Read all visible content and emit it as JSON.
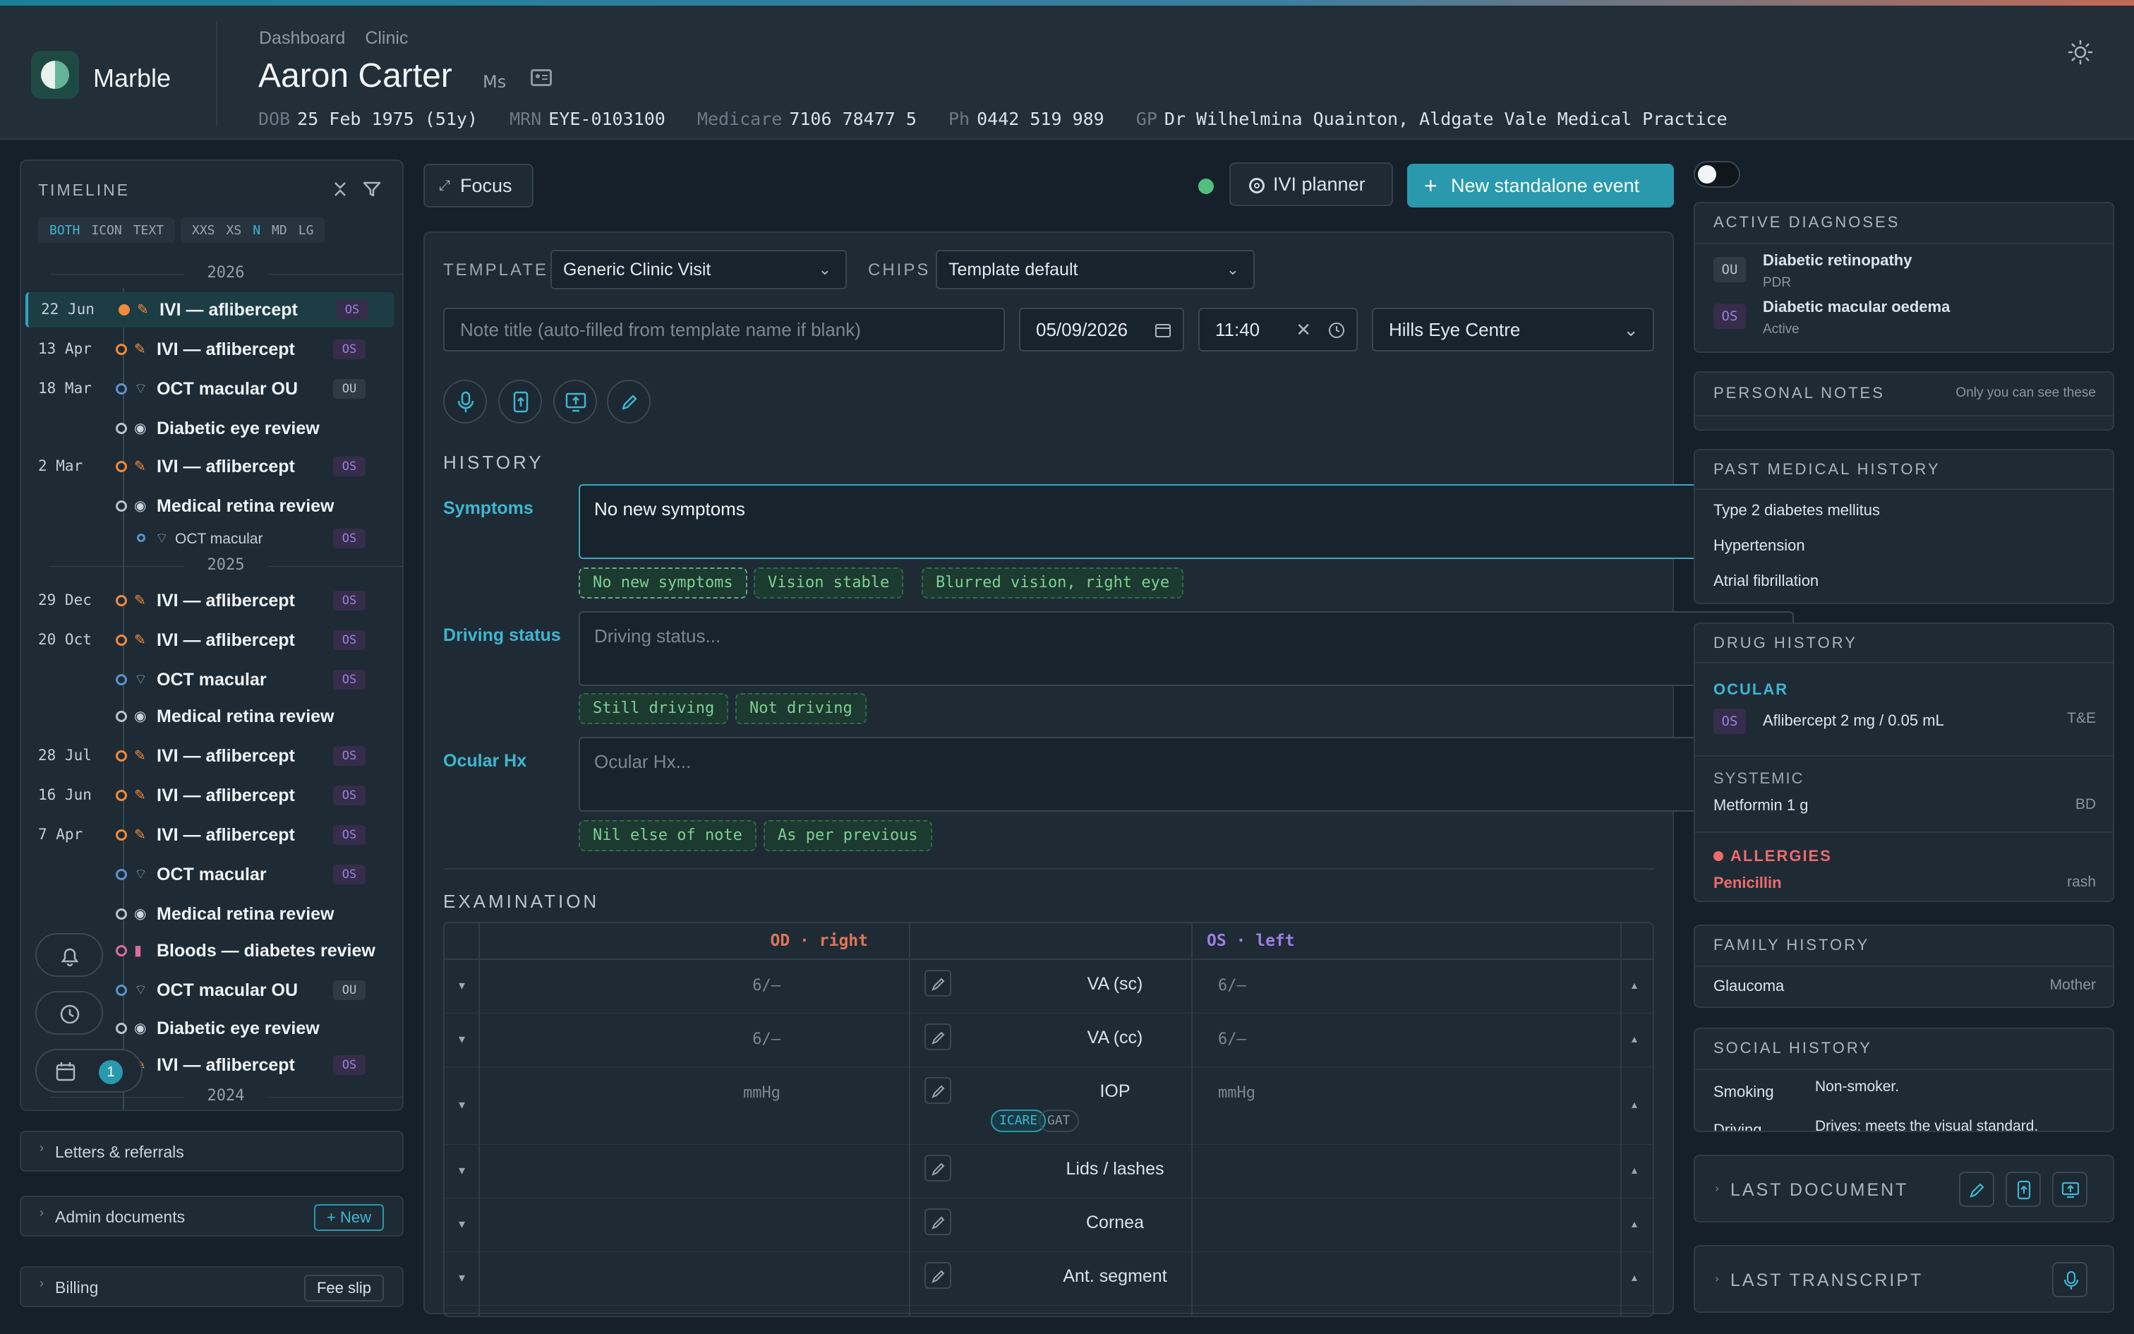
{
  "app": {
    "name": "Marble"
  },
  "breadcrumb": [
    "Dashboard",
    "Clinic"
  ],
  "patient": {
    "name": "Aaron Carter",
    "title": "Ms",
    "dob_label": "DOB",
    "dob": "25 Feb 1975 (51y)",
    "mrn_label": "MRN",
    "mrn": "EYE-0103100",
    "medicare_label": "Medicare",
    "medicare": "7106 78477 5",
    "ph_label": "Ph",
    "ph": "0442 519 989",
    "gp_label": "GP",
    "gp": "Dr Wilhelmina Quainton, Aldgate Vale Medical Practice"
  },
  "timeline": {
    "title": "TIMELINE",
    "view_modes": [
      "BOTH",
      "ICON",
      "TEXT"
    ],
    "sizes": [
      "XXS",
      "XS",
      "N",
      "MD",
      "LG"
    ],
    "years": [
      "2026",
      "2025",
      "2024"
    ],
    "items": [
      {
        "date": "22 Jun",
        "label": "IVI — aflibercept",
        "eye": "OS"
      },
      {
        "date": "13 Apr",
        "label": "IVI — aflibercept",
        "eye": "OS"
      },
      {
        "date": "18 Mar",
        "label": "OCT macular OU",
        "eye": "OU"
      },
      {
        "date": "",
        "label": "Diabetic eye review",
        "eye": ""
      },
      {
        "date": "2 Mar",
        "label": "IVI — aflibercept",
        "eye": "OS"
      },
      {
        "date": "",
        "label": "Medical retina review",
        "eye": ""
      },
      {
        "date": "",
        "label": "OCT macular",
        "eye": "OS"
      },
      {
        "date": "29 Dec",
        "label": "IVI — aflibercept",
        "eye": "OS"
      },
      {
        "date": "20 Oct",
        "label": "IVI — aflibercept",
        "eye": "OS"
      },
      {
        "date": "",
        "label": "OCT macular",
        "eye": "OS"
      },
      {
        "date": "",
        "label": "Medical retina review",
        "eye": ""
      },
      {
        "date": "28 Jul",
        "label": "IVI — aflibercept",
        "eye": "OS"
      },
      {
        "date": "16 Jun",
        "label": "IVI — aflibercept",
        "eye": "OS"
      },
      {
        "date": "7 Apr",
        "label": "IVI — aflibercept",
        "eye": "OS"
      },
      {
        "date": "",
        "label": "OCT macular",
        "eye": "OS"
      },
      {
        "date": "",
        "label": "Medical retina review",
        "eye": ""
      },
      {
        "date": "",
        "label": "Bloods — diabetes review",
        "eye": ""
      },
      {
        "date": "",
        "label": "OCT macular OU",
        "eye": "OU"
      },
      {
        "date": "",
        "label": "Diabetic eye review",
        "eye": ""
      },
      {
        "date": "",
        "label": "IVI — aflibercept",
        "eye": "OS"
      }
    ],
    "badge_count": "1"
  },
  "sidebar_sections": {
    "letters": "Letters & referrals",
    "admin": "Admin documents",
    "admin_btn": "+ New",
    "billing": "Billing",
    "billing_btn": "Fee slip"
  },
  "toolbar": {
    "focus": "Focus",
    "ivi_planner": "IVI planner",
    "new_event": "New standalone event"
  },
  "form": {
    "template_label": "TEMPLATE",
    "template_value": "Generic Clinic Visit",
    "chips_label": "CHIPS",
    "chips_value": "Template default",
    "title_placeholder": "Note title (auto-filled from template name if blank)",
    "date": "05/09/2026",
    "time": "11:40",
    "location": "Hills Eye Centre"
  },
  "history": {
    "title": "HISTORY",
    "symptoms_label": "Symptoms",
    "symptoms_value": "No new symptoms",
    "symptoms_chips": [
      "No new symptoms",
      "Vision stable",
      "Blurred vision, right eye"
    ],
    "driving_label": "Driving status",
    "driving_placeholder": "Driving status...",
    "driving_chips": [
      "Still driving",
      "Not driving"
    ],
    "ocular_label": "Ocular Hx",
    "ocular_placeholder": "Ocular Hx...",
    "ocular_chips": [
      "Nil else of note",
      "As per previous"
    ]
  },
  "examination": {
    "title": "EXAMINATION",
    "od_header": "OD · right",
    "os_header": "OS · left",
    "rows": [
      {
        "name": "VA (sc)",
        "od": "6/–",
        "os": "6/–"
      },
      {
        "name": "VA (cc)",
        "od": "6/–",
        "os": "6/–"
      },
      {
        "name": "IOP",
        "od": "mmHg",
        "os": "mmHg"
      },
      {
        "name": "Lids / lashes",
        "od": "",
        "os": ""
      },
      {
        "name": "Cornea",
        "od": "",
        "os": ""
      },
      {
        "name": "Ant. segment",
        "od": "",
        "os": ""
      }
    ],
    "iop_methods": [
      "ICARE",
      "GAT"
    ]
  },
  "right": {
    "active_diagnoses": {
      "title": "ACTIVE DIAGNOSES",
      "items": [
        {
          "eye": "OU",
          "name": "Diabetic retinopathy",
          "sub": "PDR"
        },
        {
          "eye": "OS",
          "name": "Diabetic macular oedema",
          "sub": "Active"
        }
      ]
    },
    "personal_notes": {
      "title": "PERSONAL NOTES",
      "hint": "Only you can see these"
    },
    "pmh": {
      "title": "PAST MEDICAL HISTORY",
      "items": [
        "Type 2 diabetes mellitus",
        "Hypertension",
        "Atrial fibrillation"
      ]
    },
    "drug": {
      "title": "DRUG HISTORY",
      "ocular_label": "OCULAR",
      "ocular_eye": "OS",
      "ocular_drug": "Aflibercept 2 mg / 0.05 mL",
      "ocular_regimen": "T&E",
      "systemic_label": "SYSTEMIC",
      "systemic_drug": "Metformin 1 g",
      "systemic_freq": "BD",
      "allergies_label": "ALLERGIES",
      "allergy": "Penicillin",
      "reaction": "rash"
    },
    "family": {
      "title": "FAMILY HISTORY",
      "condition": "Glaucoma",
      "relation": "Mother"
    },
    "social": {
      "title": "SOCIAL HISTORY",
      "smoking_label": "Smoking",
      "smoking": "Non-smoker.",
      "driving_label": "Driving",
      "driving": "Drives; meets the visual standard."
    },
    "last_document": "LAST DOCUMENT",
    "last_transcript": "LAST TRANSCRIPT"
  },
  "colors": {
    "accent": "#2a98ad",
    "od": "#e0755a",
    "os": "#9d7ee0",
    "ivi": "#f08a3c",
    "allergy": "#ef6b6b"
  }
}
